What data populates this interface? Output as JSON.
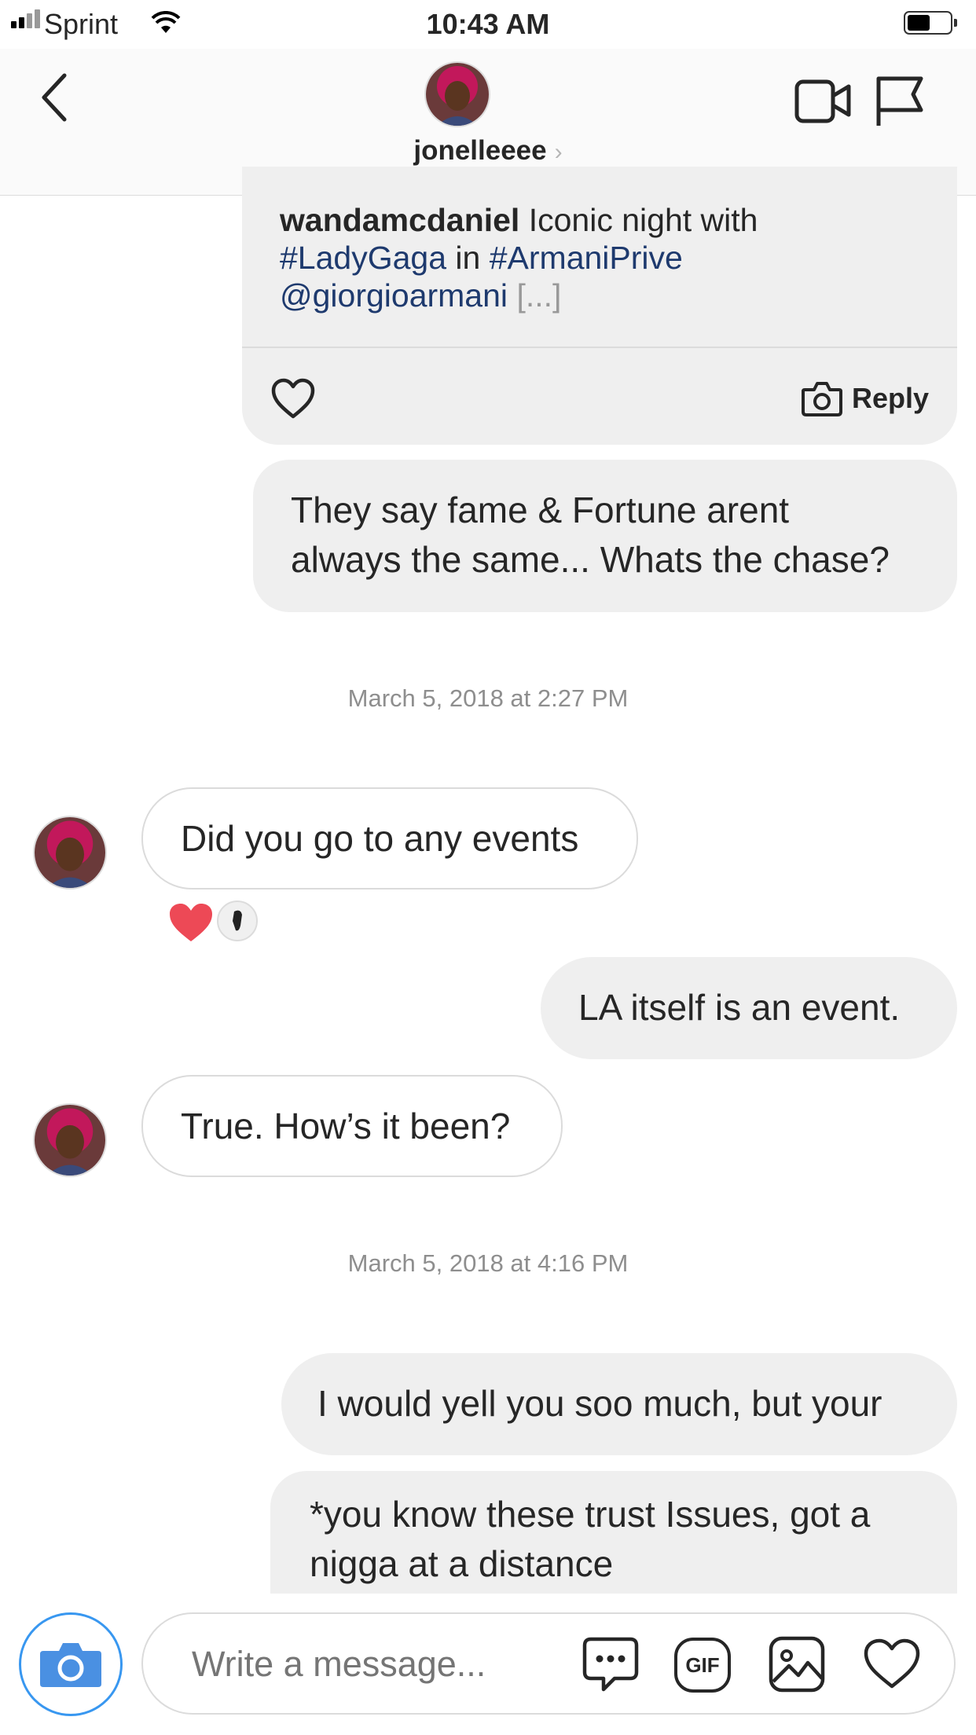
{
  "status_bar": {
    "carrier": "Sprint",
    "time": "10:43 AM"
  },
  "header": {
    "username": "jonelleeee"
  },
  "shared_post": {
    "author": "wandamcdaniel",
    "caption_start": "Iconic night with",
    "tag1": "#LadyGaga",
    "connector": "in",
    "tag2": "#ArmaniPrive",
    "mention": "@giorgioarmani",
    "truncation": "[...]",
    "reply_label": "Reply"
  },
  "messages": [
    {
      "text_line1": "They say fame & Fortune arent",
      "text_line2": "always the same... Whats the chase?"
    },
    {
      "text": "Did you go to any events"
    },
    {
      "text": "LA itself is an event."
    },
    {
      "text": "True. How’s it been?"
    },
    {
      "text": "I would yell you soo much, but your"
    },
    {
      "text_line1": "*you know these trust Issues, got a",
      "text_line2": "nigga at a distance"
    }
  ],
  "timestamps": [
    "March 5, 2018 at 2:27 PM",
    "March 5, 2018 at 4:16 PM"
  ],
  "composer": {
    "placeholder": "Write a message...",
    "gif_label": "GIF"
  },
  "colors": {
    "accent_blue": "#3897f0",
    "reaction_heart": "#ed4956",
    "link": "#1e3a6e"
  }
}
